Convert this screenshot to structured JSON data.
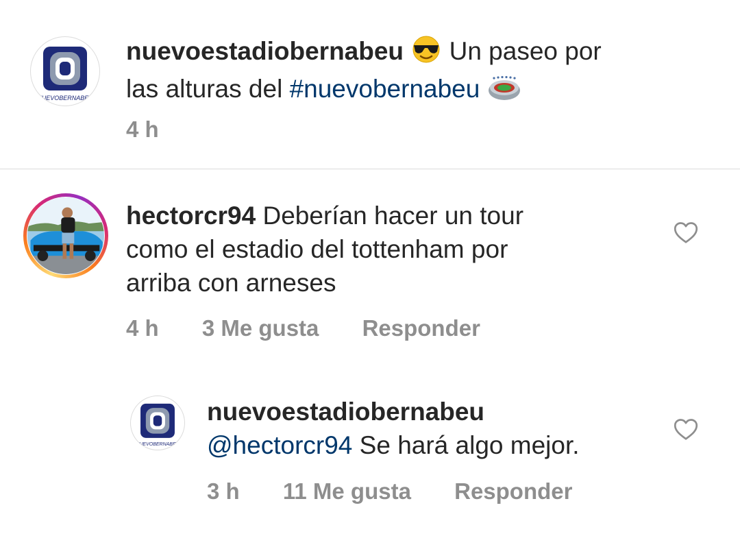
{
  "caption": {
    "username": "nuevoestadiobernabeu",
    "emoji_1": "sunglasses-emoji",
    "text_1": "Un paseo por",
    "text_2": "las alturas del",
    "hashtag": "#nuevobernabeu",
    "emoji_2": "stadium-emoji",
    "time": "4 h",
    "avatar_text": "NUEVOBERNABEU"
  },
  "comments": [
    {
      "username": "hectorcr94",
      "line_1": "Deberían hacer un tour",
      "line_2": "como el estadio del tottenham por",
      "line_3": "arriba con arneses",
      "time": "4 h",
      "likes": "3 Me gusta",
      "reply": "Responder",
      "icon": "heart-outline-icon"
    },
    {
      "username": "nuevoestadiobernabeu",
      "mention": "@hectorcr94",
      "text": "Se hará algo mejor.",
      "time": "3 h",
      "likes": "11 Me gusta",
      "reply": "Responder",
      "icon": "heart-outline-icon",
      "avatar_text": "NUEVOBERNABEU"
    }
  ],
  "colors": {
    "text": "#262626",
    "meta": "#8e8e8e",
    "link": "#00376b",
    "divider": "#dbdbdb",
    "logo_navy": "#1e2a78"
  }
}
